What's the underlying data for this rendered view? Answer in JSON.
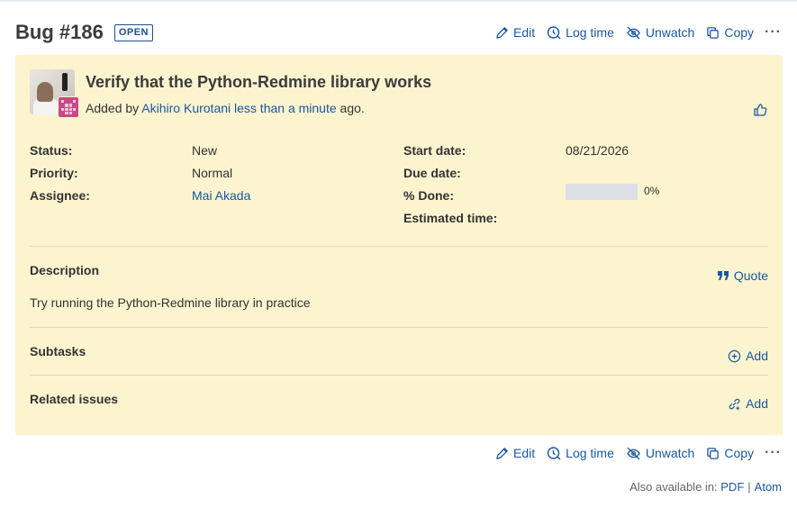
{
  "header": {
    "title": "Bug #186",
    "status_badge": "OPEN"
  },
  "actions": {
    "edit": "Edit",
    "log_time": "Log time",
    "unwatch": "Unwatch",
    "copy": "Copy",
    "more": "···"
  },
  "issue": {
    "subject": "Verify that the Python-Redmine library works",
    "added_prefix": "Added by",
    "author": "Akihiro Kurotani",
    "time_ago": "less than a minute",
    "added_suffix": "ago."
  },
  "attributes": {
    "status_label": "Status:",
    "status_value": "New",
    "priority_label": "Priority:",
    "priority_value": "Normal",
    "assignee_label": "Assignee:",
    "assignee_value": "Mai Akada",
    "start_date_label": "Start date:",
    "start_date_value": "08/21/2026",
    "due_date_label": "Due date:",
    "due_date_value": "",
    "done_label": "% Done:",
    "done_percent": 0,
    "done_text": "0%",
    "estimated_label": "Estimated time:",
    "estimated_value": ""
  },
  "description": {
    "title": "Description",
    "quote_label": "Quote",
    "text": "Try running the Python-Redmine library in practice"
  },
  "subtasks": {
    "title": "Subtasks",
    "add_label": "Add"
  },
  "related": {
    "title": "Related issues",
    "add_label": "Add"
  },
  "footer": {
    "also_available": "Also available in:",
    "pdf": "PDF",
    "separator": "|",
    "atom": "Atom"
  },
  "colors": {
    "card_background": "#fbf4cf",
    "link": "#1a57a2",
    "badge": "#1e4d91"
  },
  "icons": [
    "pencil-icon",
    "clock-icon",
    "eye-off-icon",
    "copy-icon",
    "more-icon",
    "thumbs-up-icon",
    "quote-icon",
    "plus-circle-icon",
    "link-add-icon"
  ]
}
